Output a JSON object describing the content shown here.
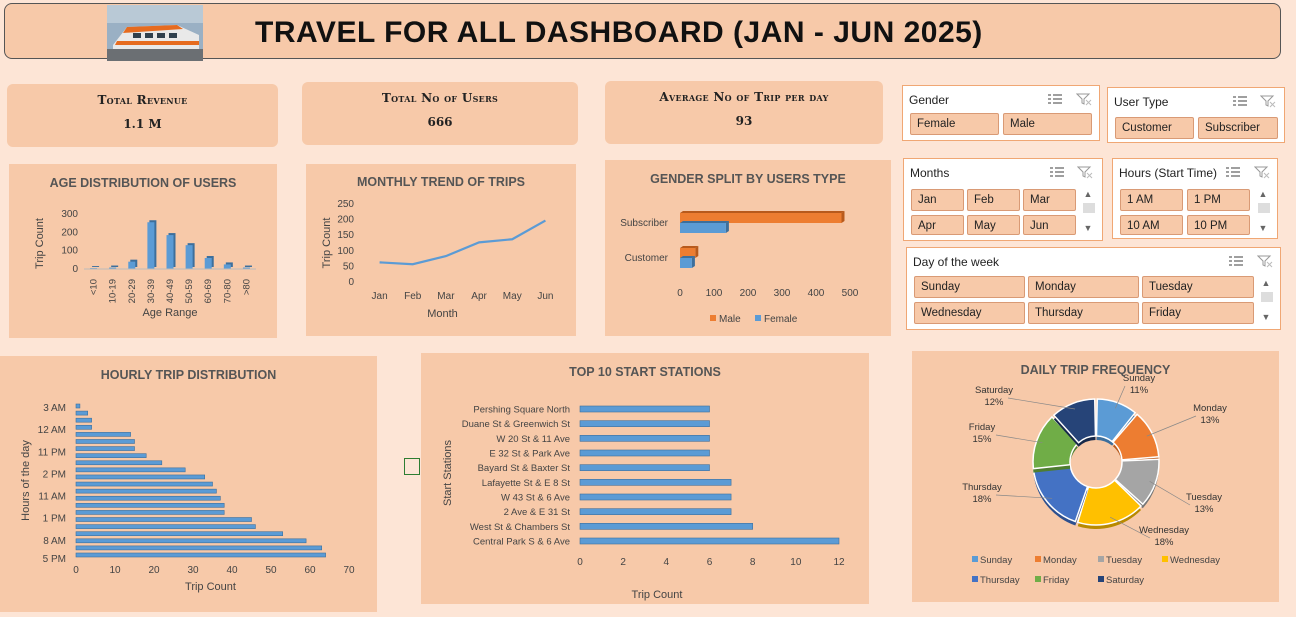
{
  "header": {
    "title": "TRAVEL FOR ALL  DASHBOARD (JAN - JUN 2025)"
  },
  "kpis": [
    {
      "label": "Total Revenue",
      "value": "1.1 M"
    },
    {
      "label": "Total No of Users",
      "value": "666"
    },
    {
      "label": "Average No of Trip per day",
      "value": "93"
    }
  ],
  "slicers": {
    "gender": {
      "title": "Gender",
      "items": [
        "Female",
        "Male"
      ]
    },
    "user_type": {
      "title": "User Type",
      "items": [
        "Customer",
        "Subscriber"
      ]
    },
    "months": {
      "title": "Months",
      "items": [
        "Jan",
        "Feb",
        "Mar",
        "Apr",
        "May",
        "Jun"
      ]
    },
    "hours": {
      "title": "Hours (Start Time)",
      "items": [
        "1 AM",
        "1 PM",
        "10 AM",
        "10 PM"
      ]
    },
    "day": {
      "title": "Day of the week",
      "items": [
        "Sunday",
        "Monday",
        "Tuesday",
        "Wednesday",
        "Thursday",
        "Friday"
      ]
    }
  },
  "colors": {
    "bar_blue": "#5b9bd5",
    "orange": "#ed7d31",
    "gray": "#a5a5a5",
    "yellow": "#ffc000",
    "dark_blue": "#264478",
    "green": "#70ad47",
    "panel": "#f7c9a9",
    "background": "#fde5d6"
  },
  "chart_data": [
    {
      "id": "age",
      "type": "bar",
      "title": "AGE DISTRIBUTION OF USERS",
      "xlabel": "Age Range",
      "ylabel": "Trip Count",
      "categories": [
        "<10",
        "10-19",
        "20-29",
        "30-39",
        "40-49",
        "50-59",
        "60-69",
        "70-80",
        ">80"
      ],
      "values": [
        5,
        8,
        40,
        255,
        185,
        130,
        60,
        25,
        8
      ],
      "ylim": [
        0,
        300
      ],
      "yticks": [
        0,
        100,
        200,
        300
      ]
    },
    {
      "id": "monthly",
      "type": "line",
      "title": "MONTHLY TREND OF TRIPS",
      "xlabel": "Month",
      "ylabel": "Trip Count",
      "categories": [
        "Jan",
        "Feb",
        "Mar",
        "Apr",
        "May",
        "Jun"
      ],
      "values": [
        63,
        57,
        83,
        127,
        137,
        197
      ],
      "ylim": [
        0,
        250
      ],
      "yticks": [
        0,
        50,
        100,
        150,
        200,
        250
      ]
    },
    {
      "id": "gender_split",
      "type": "bar",
      "title": "GENDER SPLIT BY USERS TYPE",
      "categories": [
        "Subscriber",
        "Customer"
      ],
      "series": [
        {
          "name": "Male",
          "values": [
            475,
            45
          ]
        },
        {
          "name": "Female",
          "values": [
            135,
            35
          ]
        }
      ],
      "xlim": [
        0,
        500
      ],
      "xticks": [
        0,
        100,
        200,
        300,
        400,
        500
      ],
      "legend": "bottom"
    },
    {
      "id": "hourly",
      "type": "bar",
      "title": "HOURLY TRIP DISTRIBUTION",
      "xlabel": "Trip Count",
      "ylabel": "Hours of the day",
      "tick_labels": [
        "3 AM",
        "12 AM",
        "11 PM",
        "2 PM",
        "11 AM",
        "1 PM",
        "8 AM",
        "5 PM"
      ],
      "values": [
        1,
        3,
        4,
        4,
        14,
        15,
        15,
        18,
        22,
        28,
        33,
        35,
        36,
        37,
        38,
        38,
        45,
        46,
        53,
        59,
        63,
        64
      ],
      "xlim": [
        0,
        70
      ],
      "xticks": [
        0,
        10,
        20,
        30,
        40,
        50,
        60,
        70
      ]
    },
    {
      "id": "stations",
      "type": "bar",
      "title": "TOP 10 START STATIONS",
      "xlabel": "Trip Count",
      "ylabel": "Start Stations",
      "categories": [
        "Pershing Square North",
        "Duane St & Greenwich St",
        "W 20 St & 11 Ave",
        "E 32 St & Park Ave",
        "Bayard St & Baxter St",
        "Lafayette St & E 8 St",
        "W 43 St & 6 Ave",
        "2 Ave & E 31 St",
        "West St & Chambers St",
        "Central Park S & 6 Ave"
      ],
      "values": [
        6,
        6,
        6,
        6,
        6,
        7,
        7,
        7,
        8,
        12
      ],
      "xlim": [
        0,
        12
      ],
      "xticks": [
        0,
        2,
        4,
        6,
        8,
        10,
        12
      ]
    },
    {
      "id": "daily",
      "type": "pie",
      "title": "DAILY TRIP FREQUENCY",
      "categories": [
        "Sunday",
        "Monday",
        "Tuesday",
        "Wednesday",
        "Thursday",
        "Friday",
        "Saturday"
      ],
      "values": [
        11,
        13,
        13,
        18,
        18,
        15,
        12
      ],
      "labels": [
        "11%",
        "13%",
        "13%",
        "18%",
        "18%",
        "15%",
        "12%"
      ],
      "colors": [
        "#5b9bd5",
        "#ed7d31",
        "#a5a5a5",
        "#ffc000",
        "#4472c4",
        "#70ad47",
        "#264478"
      ]
    }
  ]
}
